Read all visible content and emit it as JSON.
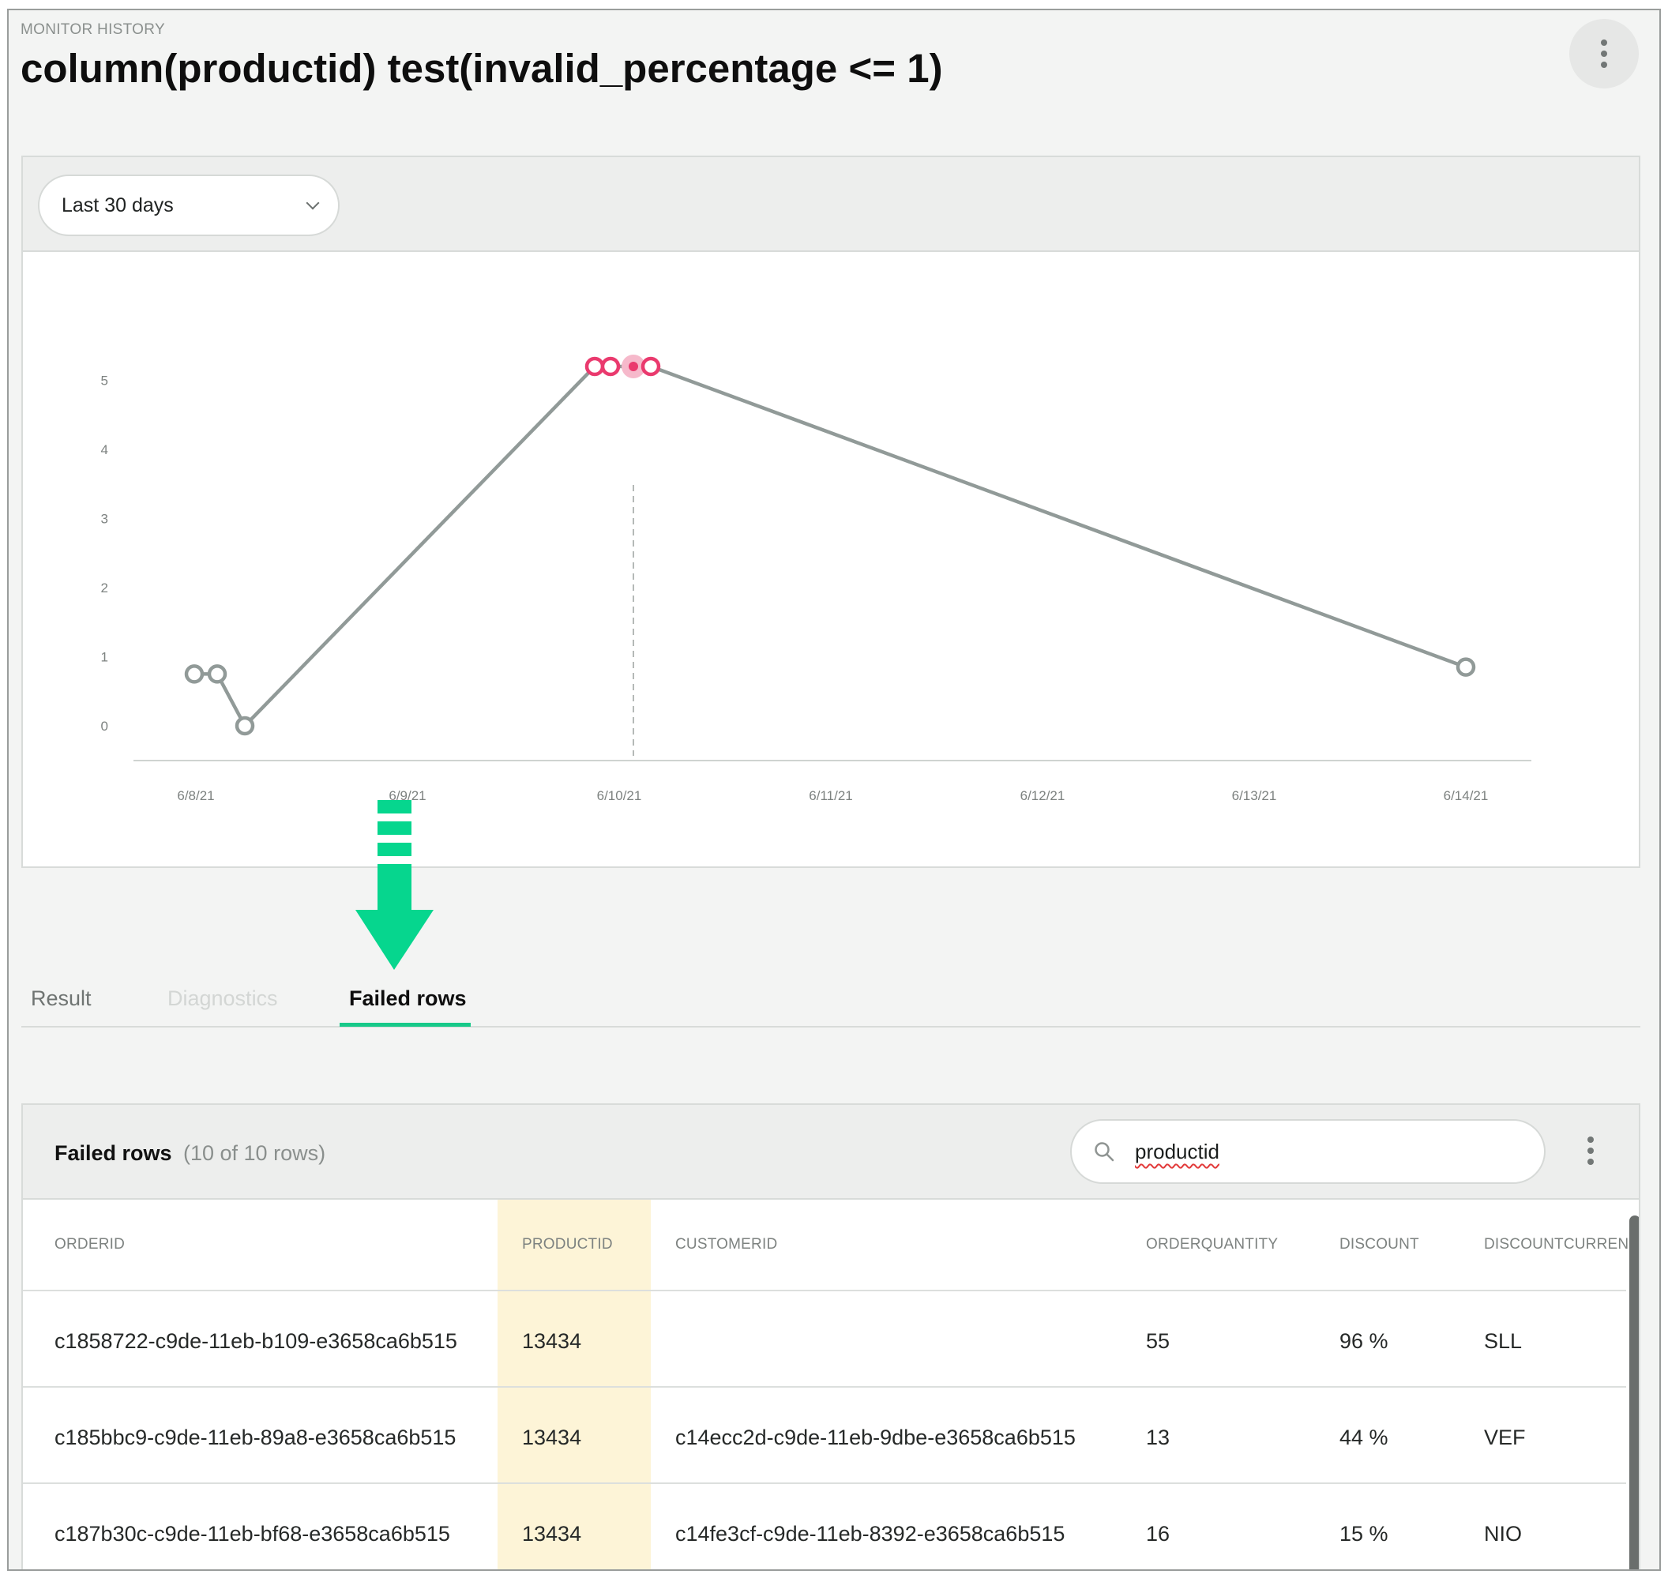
{
  "header": {
    "overline": "MONITOR HISTORY",
    "title": "column(productid) test(invalid_percentage <= 1)",
    "menu_icon": "kebab-vertical-icon"
  },
  "range_select": {
    "value": "Last 30 days",
    "icon": "chevron-down-icon"
  },
  "chart_data": {
    "type": "line",
    "x_tick_labels": [
      "6/8/21",
      "6/9/21",
      "6/10/21",
      "6/11/21",
      "6/12/21",
      "6/13/21",
      "6/14/21"
    ],
    "y_tick_labels": [
      "0",
      "1",
      "2",
      "3",
      "4",
      "5"
    ],
    "ylim": [
      0,
      5
    ],
    "points": [
      {
        "x": "6/8/21",
        "y": 0.75,
        "status": "pass"
      },
      {
        "x": "6/8/21",
        "y": 0.75,
        "status": "pass"
      },
      {
        "x": "6/8/21",
        "y": 0,
        "status": "pass"
      },
      {
        "x": "6/10/21",
        "y": 5.2,
        "status": "fail"
      },
      {
        "x": "6/10/21",
        "y": 5.2,
        "status": "fail"
      },
      {
        "x": "6/10/21",
        "y": 5.2,
        "status": "fail-selected"
      },
      {
        "x": "6/10/21",
        "y": 5.2,
        "status": "fail"
      },
      {
        "x": "6/14/21",
        "y": 0.85,
        "status": "pass"
      }
    ],
    "selected_x": "6/10/21",
    "colors": {
      "line": "#919a98",
      "fail": "#ea3a6e",
      "pass": "#919a98",
      "arrow": "#06d68e"
    }
  },
  "tabs": [
    {
      "label": "Result",
      "state": "inactive"
    },
    {
      "label": "Diagnostics",
      "state": "disabled"
    },
    {
      "label": "Failed rows",
      "state": "active"
    }
  ],
  "failed_rows": {
    "title": "Failed rows",
    "count": "(10 of 10 rows)",
    "search": {
      "value": "productid",
      "icon": "search-icon"
    },
    "menu_icon": "kebab-vertical-icon",
    "columns": [
      "ORDERID",
      "PRODUCTID",
      "CUSTOMERID",
      "ORDERQUANTITY",
      "DISCOUNT",
      "DISCOUNTCURRENCY"
    ],
    "rows": [
      [
        "c1858722-c9de-11eb-b109-e3658ca6b515",
        "13434",
        "",
        "55",
        "96 %",
        "SLL"
      ],
      [
        "c185bbc9-c9de-11eb-89a8-e3658ca6b515",
        "13434",
        "c14ecc2d-c9de-11eb-9dbe-e3658ca6b515",
        "13",
        "44 %",
        "VEF"
      ],
      [
        "c187b30c-c9de-11eb-bf68-e3658ca6b515",
        "13434",
        "c14fe3cf-c9de-11eb-8392-e3658ca6b515",
        "16",
        "15 %",
        "NIO"
      ]
    ]
  }
}
